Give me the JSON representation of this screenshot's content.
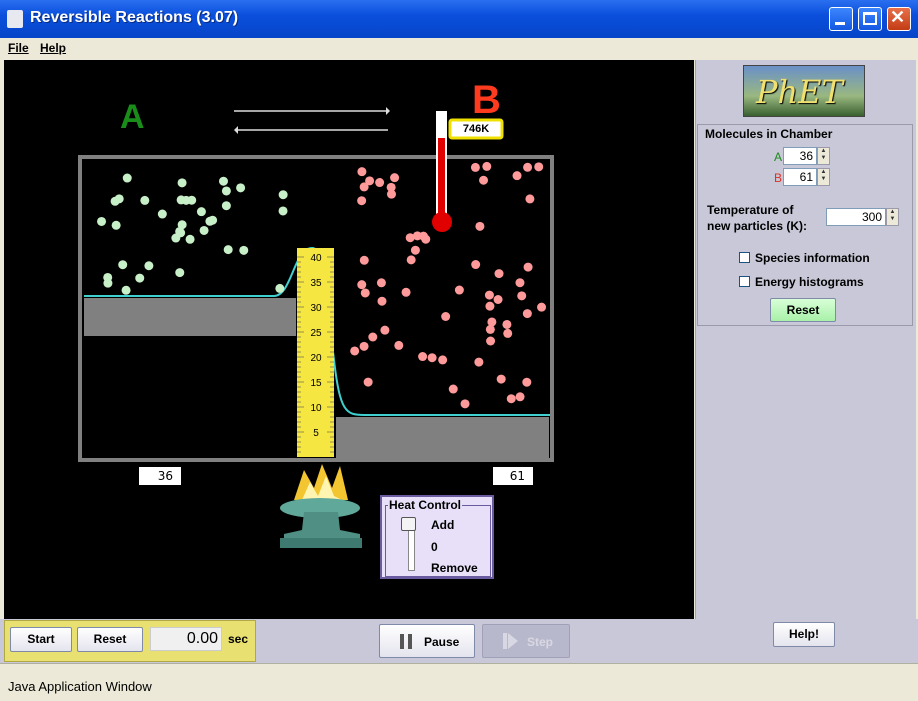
{
  "window": {
    "title": "Reversible Reactions (3.07)"
  },
  "menu": {
    "file": "File",
    "help": "Help"
  },
  "simulation": {
    "label_a": "A",
    "label_b": "B",
    "thermometer_value": "746K",
    "count_a": "36",
    "count_b": "61",
    "ruler_ticks": [
      "40",
      "35",
      "30",
      "25",
      "20",
      "15",
      "10",
      "5"
    ],
    "heat_control": {
      "title": "Heat Control",
      "add": "Add",
      "zero": "0",
      "remove": "Remove"
    }
  },
  "control_panel": {
    "logo": "PhET",
    "molecules_title": "Molecules in Chamber",
    "a_label": "A",
    "a_value": "36",
    "b_label": "B",
    "b_value": "61",
    "temperature_label_1": "Temperature of",
    "temperature_label_2": "new particles (K):",
    "temperature_value": "300",
    "species_info": "Species information",
    "energy_histograms": "Energy histograms",
    "reset": "Reset",
    "help": "Help!"
  },
  "clock": {
    "start": "Start",
    "reset": "Reset",
    "time": "0.00",
    "unit": "sec",
    "pause": "Pause",
    "step": "Step"
  },
  "status_bar": "Java Application Window",
  "colors": {
    "a_green": "#1a8c1a",
    "b_red": "#ff3b1f",
    "a_particle": "#c8f0c8",
    "b_particle": "#ff9a9a",
    "curve": "#40d0d0",
    "ruler": "#f5e642"
  }
}
